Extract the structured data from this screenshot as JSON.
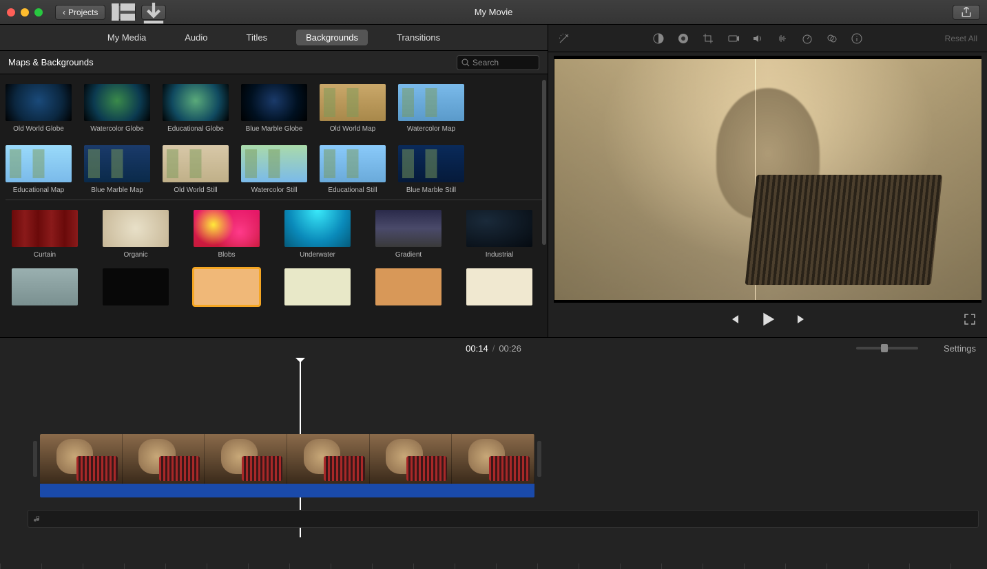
{
  "titlebar": {
    "back_label": "Projects",
    "title": "My Movie"
  },
  "tabs": [
    "My Media",
    "Audio",
    "Titles",
    "Backgrounds",
    "Transitions"
  ],
  "active_tab": "Backgrounds",
  "library": {
    "title": "Maps & Backgrounds",
    "search_placeholder": "Search"
  },
  "maps": [
    {
      "label": "Old World Globe",
      "cls": "tg-globe"
    },
    {
      "label": "Watercolor Globe",
      "cls": "tg-globe wc"
    },
    {
      "label": "Educational Globe",
      "cls": "tg-globe edu"
    },
    {
      "label": "Blue Marble Globe",
      "cls": "tg-globe bm"
    },
    {
      "label": "Old World Map",
      "cls": "tg-map"
    },
    {
      "label": "Watercolor Map",
      "cls": "tg-map wc"
    },
    {
      "label": "Educational Map",
      "cls": "tg-map edu"
    },
    {
      "label": "Blue Marble Map",
      "cls": "tg-map bm"
    },
    {
      "label": "Old World Still",
      "cls": "tg-map ows"
    },
    {
      "label": "Watercolor Still",
      "cls": "tg-map wcs"
    },
    {
      "label": "Educational Still",
      "cls": "tg-map edus"
    },
    {
      "label": "Blue Marble Still",
      "cls": "tg-map bms"
    }
  ],
  "backgrounds": [
    {
      "label": "Curtain",
      "cls": "tbg-curtain"
    },
    {
      "label": "Organic",
      "cls": "tbg-organic"
    },
    {
      "label": "Blobs",
      "cls": "tbg-blobs"
    },
    {
      "label": "Underwater",
      "cls": "tbg-under"
    },
    {
      "label": "Gradient",
      "cls": "tbg-grad"
    },
    {
      "label": "Industrial",
      "cls": "tbg-ind"
    }
  ],
  "backgrounds_row2": [
    {
      "label": "",
      "cls": "tbg-s1"
    },
    {
      "label": "",
      "cls": "tbg-s2"
    },
    {
      "label": "",
      "cls": "tbg-s3",
      "sel": true
    },
    {
      "label": "",
      "cls": "tbg-s4"
    },
    {
      "label": "",
      "cls": "tbg-s5"
    },
    {
      "label": "",
      "cls": "tbg-s6"
    }
  ],
  "preview": {
    "reset_label": "Reset All"
  },
  "timeline": {
    "current": "00:14",
    "total": "00:26",
    "settings_label": "Settings"
  }
}
